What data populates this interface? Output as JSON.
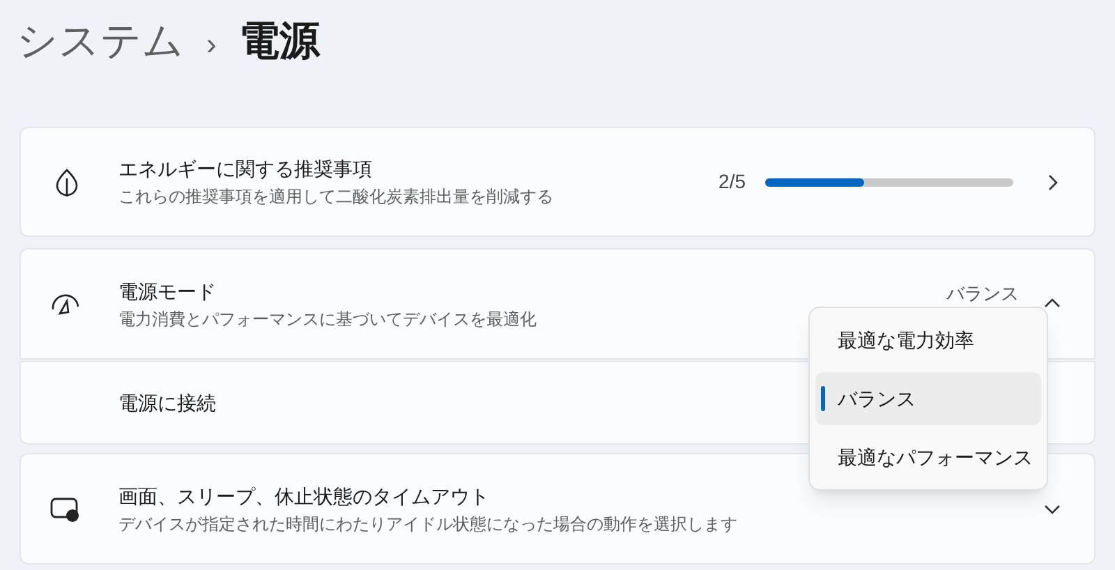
{
  "breadcrumb": {
    "parent": "システム",
    "separator": "›",
    "current": "電源"
  },
  "recommendations": {
    "title": "エネルギーに関する推奨事項",
    "description": "これらの推奨事項を適用して二酸化炭素排出量を削減する",
    "count": "2/5",
    "level": 0.4
  },
  "power_mode": {
    "title": "電源モード",
    "description": "電力消費とパフォーマンスに基づいてデバイスを最適化",
    "value": "バランス",
    "expanded": true,
    "sub_row": {
      "label": "電源に接続"
    },
    "options": [
      {
        "label": "最適な電力効率",
        "selected": false
      },
      {
        "label": "バランス",
        "selected": true
      },
      {
        "label": "最適なパフォーマンス",
        "selected": false
      }
    ]
  },
  "timeout": {
    "title": "画面、スリープ、休止状態のタイムアウト",
    "description": "デバイスが指定された時間にわたりアイドル状態になった場合の動作を選択します",
    "expanded": false
  }
}
